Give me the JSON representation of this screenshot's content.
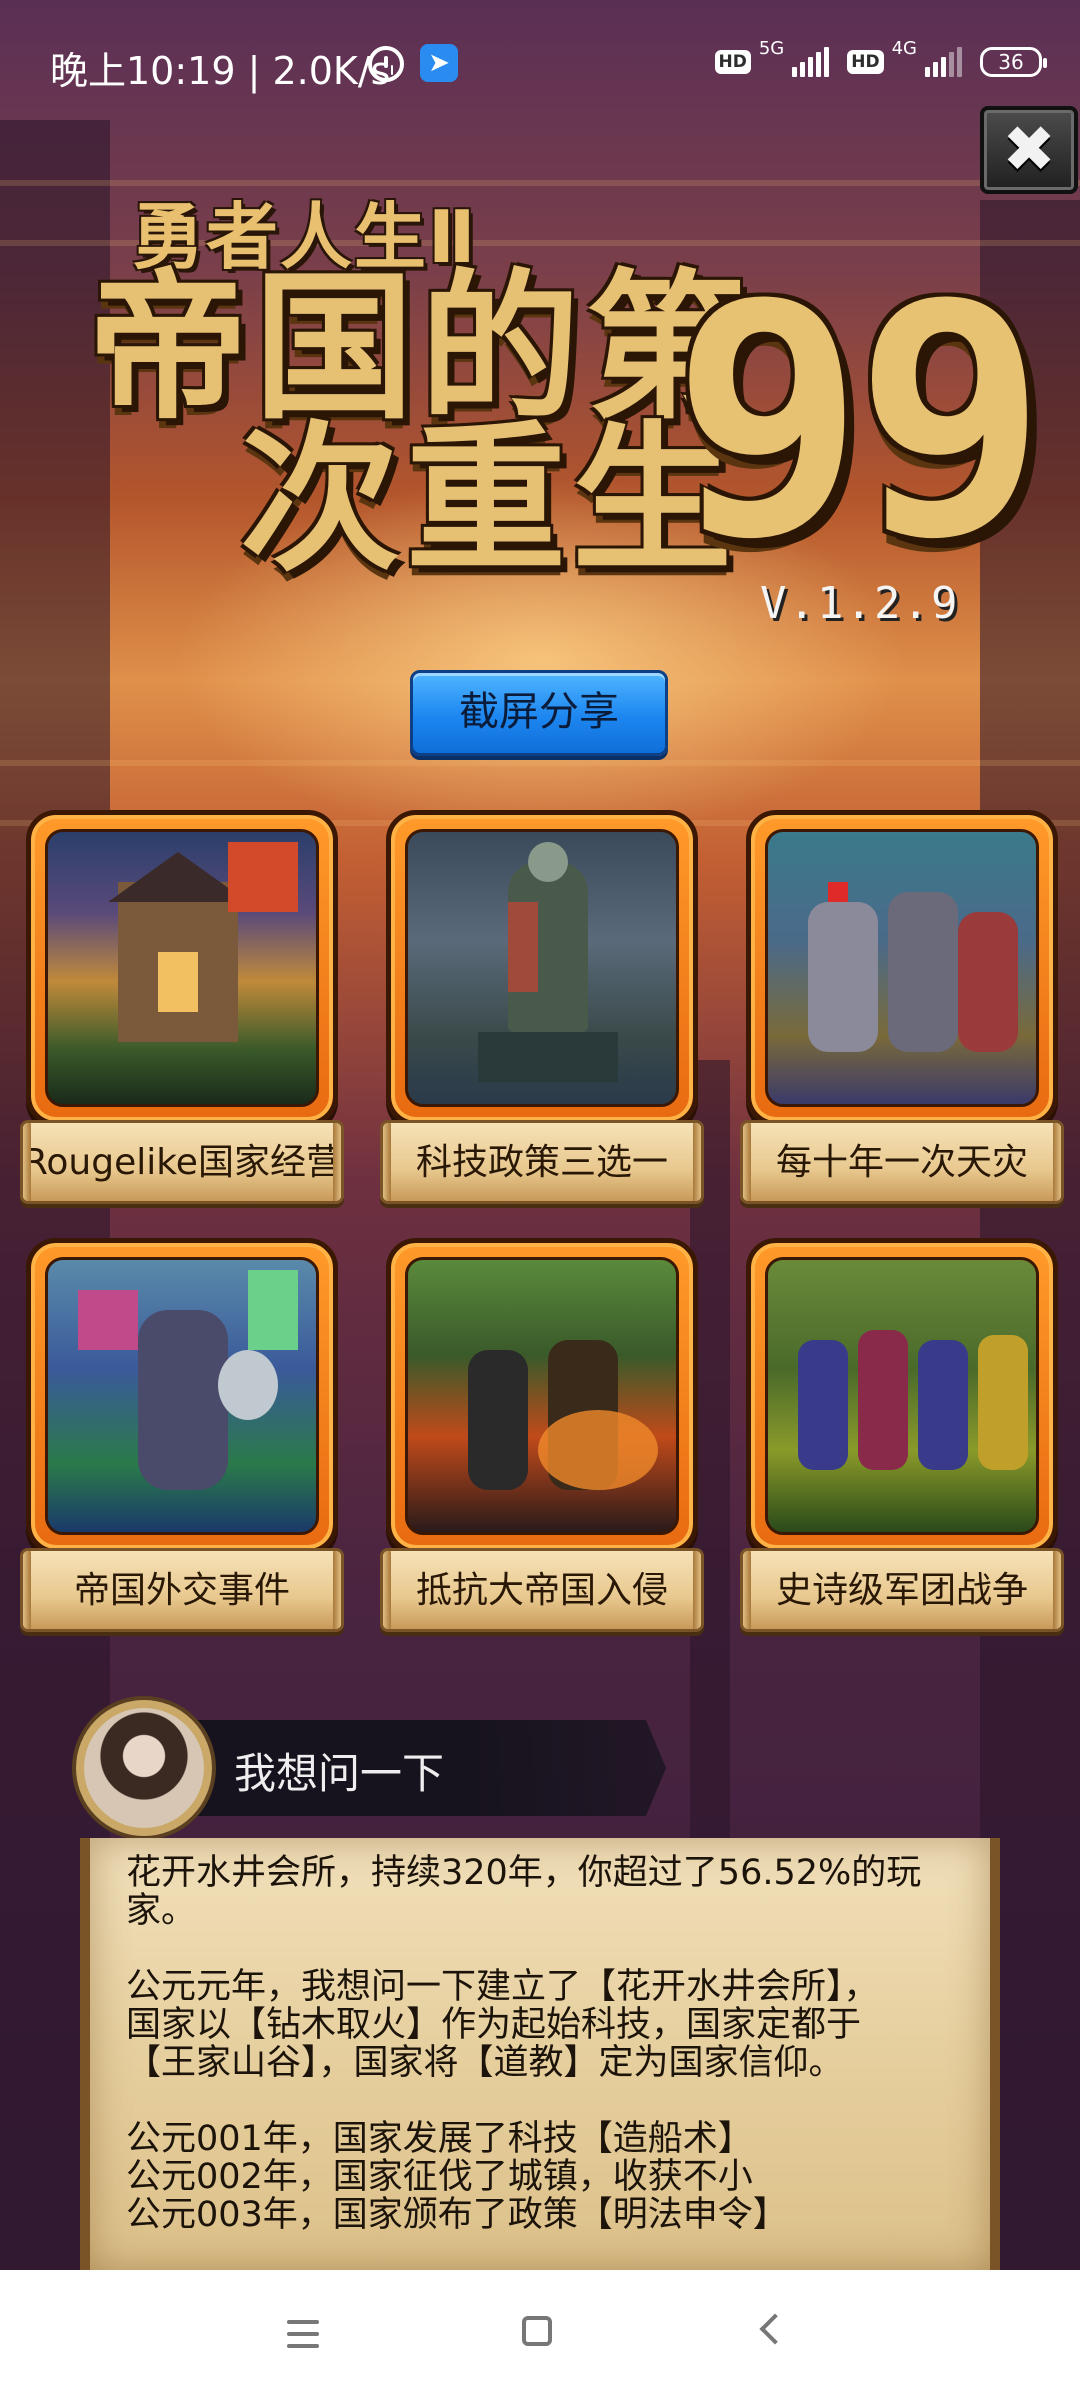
{
  "status_bar": {
    "time_text": "晚上10:19 | 2.0K/s",
    "hd_1": "HD",
    "net_1": "5G",
    "hd_2": "HD",
    "net_2": "4G",
    "battery": "36"
  },
  "game": {
    "subtitle": "勇者人生Ⅱ",
    "title_line_1": "帝国的第",
    "title_line_2": "次重生",
    "title_number": "99",
    "version": "V.1.2.9",
    "share_button": "截屏分享",
    "close_icon": "✖"
  },
  "features": [
    {
      "label": "Rougelike国家经营"
    },
    {
      "label": "科技政策三选一"
    },
    {
      "label": "每十年一次天灾"
    },
    {
      "label": "帝国外交事件"
    },
    {
      "label": "抵抗大帝国入侵"
    },
    {
      "label": "史诗级军团战争"
    }
  ],
  "chat": {
    "speaker_name": "我想问一下",
    "log_lines": [
      "花开水井会所，持续320年，你超过了56.52%的玩",
      "家。",
      "",
      "公元元年，我想问一下建立了【花开水井会所】，",
      "国家以【钻木取火】作为起始科技，国家定都于",
      "【王家山谷】，国家将【道教】定为国家信仰。",
      "",
      "公元001年，国家发展了科技【造船术】",
      "公元002年，国家征伐了城镇，收获不小",
      "公元003年，国家颁布了政策【明法申令】"
    ]
  },
  "icons": {
    "menu": "menu-icon",
    "home": "home-icon",
    "back": "back-icon"
  }
}
